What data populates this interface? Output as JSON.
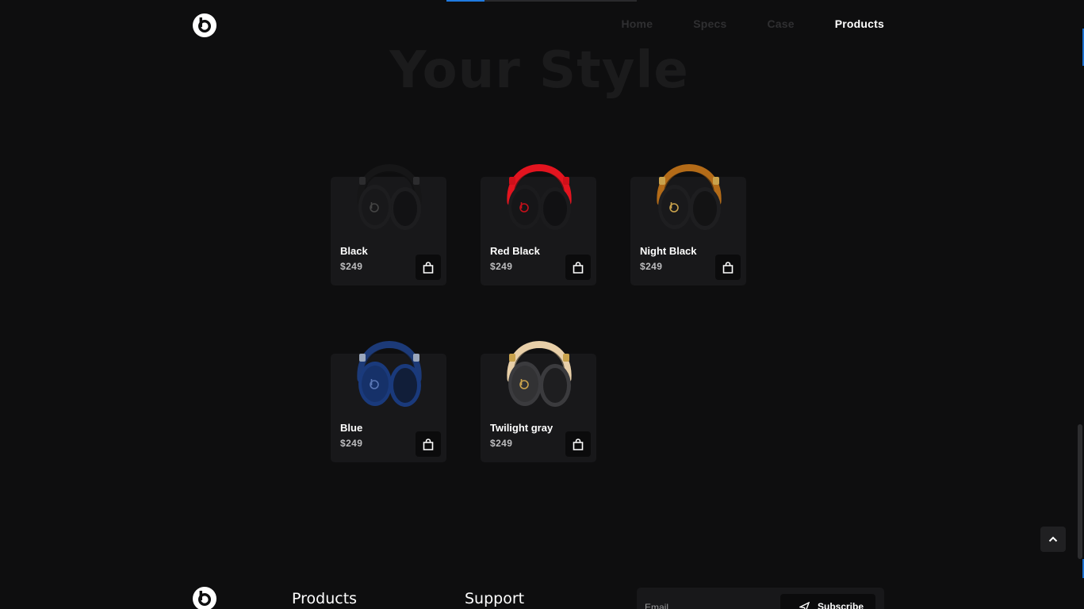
{
  "header": {
    "logo_icon": "beats-logo-icon",
    "nav": [
      {
        "label": "Home",
        "active": false
      },
      {
        "label": "Specs",
        "active": false
      },
      {
        "label": "Case",
        "active": false
      },
      {
        "label": "Products",
        "active": true
      }
    ]
  },
  "hero": {
    "title": "Your Style"
  },
  "products": [
    {
      "name": "Black",
      "price": "$249",
      "band": "#161617",
      "cup": "#1d1d1f",
      "accent": "#2c2c2e",
      "logo": "#444"
    },
    {
      "name": "Red Black",
      "price": "$249",
      "band": "#e3141f",
      "cup": "#1b1b1d",
      "accent": "#d0101a",
      "logo": "#c4101a"
    },
    {
      "name": "Night Black",
      "price": "$249",
      "band": "#b36b18",
      "cup": "#1e1e20",
      "accent": "#c9a24c",
      "logo": "#c9a24c"
    },
    {
      "name": "Blue",
      "price": "$249",
      "band": "#1c3a78",
      "cup": "#1a3a7c",
      "accent": "#9aa7bd",
      "logo": "#5a77b5"
    },
    {
      "name": "Twilight gray",
      "price": "$249",
      "band": "#e8cfa8",
      "cup": "#3b3b3e",
      "accent": "#c9a24c",
      "logo": "#c9a24c"
    }
  ],
  "footer": {
    "headings": [
      "Products",
      "Support"
    ],
    "email_placeholder": "Email",
    "subscribe_label": "Subscribe"
  },
  "colors": {
    "accent": "#1f7ae0",
    "background": "#0e0e0f",
    "card": "#18181a"
  }
}
